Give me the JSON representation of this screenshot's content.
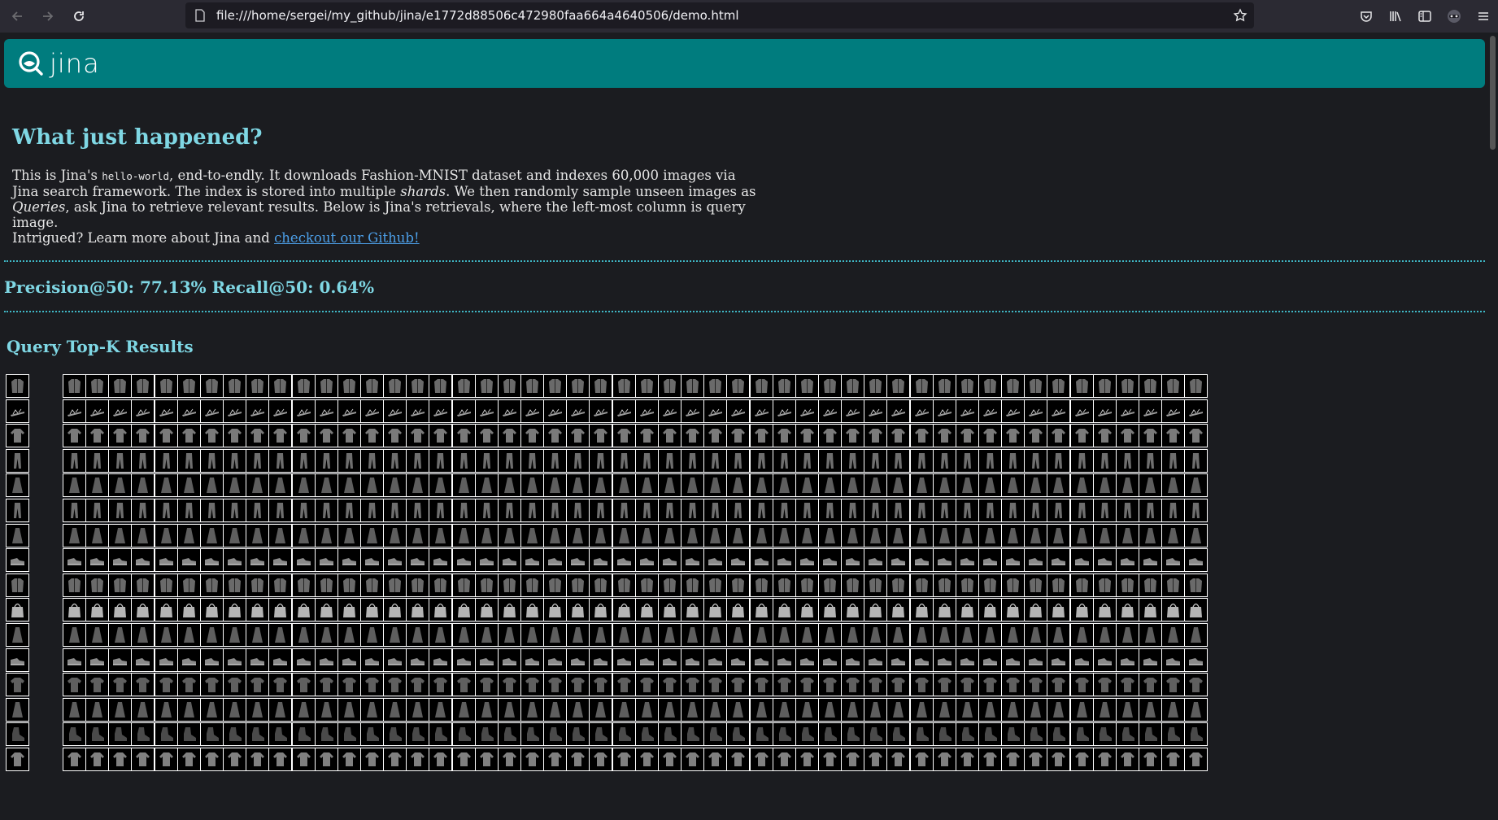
{
  "browser": {
    "url": "file:///home/sergei/my_github/jina/e1772d88506c472980faa664a4640506/demo.html"
  },
  "brand": {
    "name": "jina"
  },
  "article": {
    "title": "What just happened?",
    "p1_a": "This is Jina's ",
    "p1_code": "hello-world",
    "p1_b": ", end-to-endly. It downloads Fashion-MNIST dataset and indexes 60,000 images via Jina search framework. The index is stored into multiple ",
    "p1_shards": "shards",
    "p1_c": ". We then randomly sample unseen images as ",
    "p1_queries": "Queries",
    "p1_d": ", ask Jina to retrieve relevant results. Below is Jina's retrievals, where the left-most column is query image.",
    "p2": "Intrigued? Learn more about Jina and ",
    "link": "checkout our Github!"
  },
  "metrics": {
    "text": "Precision@50: 77.13% Recall@50: 0.64%"
  },
  "results": {
    "title": "Query Top-K Results",
    "results_per_row": 50,
    "rows": [
      {
        "category": "coat"
      },
      {
        "category": "sandal"
      },
      {
        "category": "pullover"
      },
      {
        "category": "trouser"
      },
      {
        "category": "dress"
      },
      {
        "category": "trouser"
      },
      {
        "category": "dress"
      },
      {
        "category": "sneaker"
      },
      {
        "category": "coat"
      },
      {
        "category": "bag"
      },
      {
        "category": "dress"
      },
      {
        "category": "sneaker"
      },
      {
        "category": "t-shirt"
      },
      {
        "category": "dress"
      },
      {
        "category": "ankle-boot"
      },
      {
        "category": "shirt"
      }
    ]
  }
}
